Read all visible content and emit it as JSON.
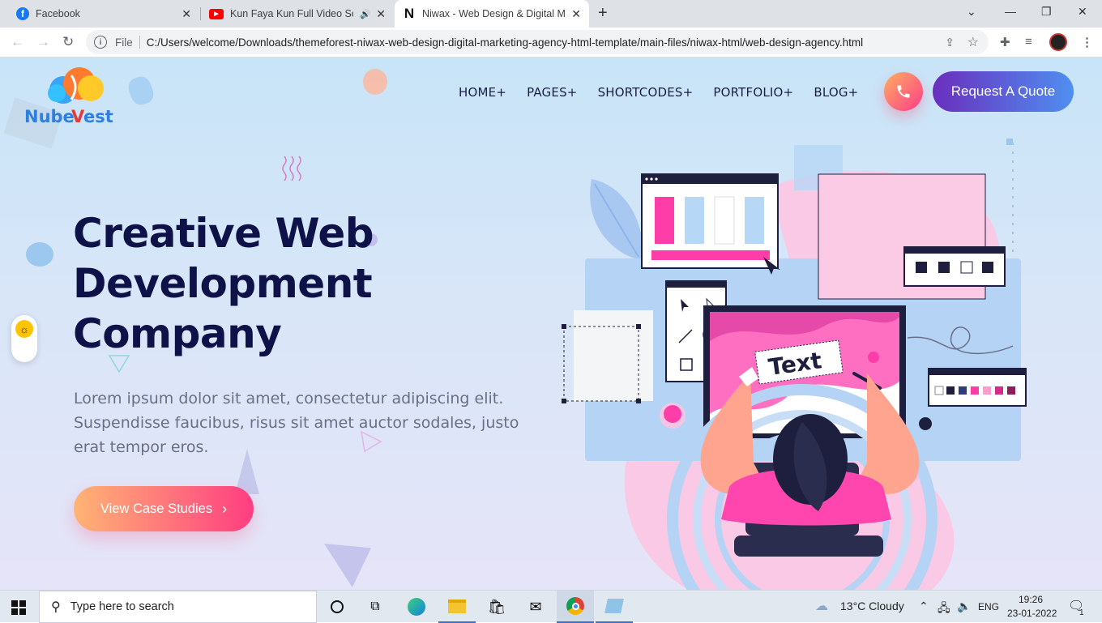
{
  "browser": {
    "tabs": [
      {
        "title": "Facebook",
        "favicon": "facebook-icon",
        "active": false
      },
      {
        "title": "Kun Faya Kun Full Video Song",
        "favicon": "youtube-icon",
        "audio": true,
        "active": false
      },
      {
        "title": "Niwax - Web Design & Digital Ma",
        "favicon": "niwax-icon",
        "favicon_letter": "N",
        "active": true
      }
    ],
    "address": {
      "scheme_label": "File",
      "url": "C:/Users/welcome/Downloads/themeforest-niwax-web-design-digital-marketing-agency-html-template/main-files/niwax-html/web-design-agency.html"
    }
  },
  "site": {
    "logo_text": "NubeVest",
    "nav": [
      "HOME+",
      "PAGES+",
      "SHORTCODES+",
      "PORTFOLIO+",
      "BLOG+"
    ],
    "quote_button": "Request A Quote",
    "hero": {
      "title": "Creative Web Development Company",
      "description": "Lorem ipsum dolor sit amet, consectetur adipiscing elit. Suspendisse faucibus, risus sit amet auctor sodales, justo erat tempor eros.",
      "cta": "View Case Studies",
      "illustration_text": "Text"
    }
  },
  "taskbar": {
    "search_placeholder": "Type here to search",
    "weather": "13°C  Cloudy",
    "language": "ENG",
    "time": "19:26",
    "date": "23-01-2022",
    "notification_count": "1"
  },
  "colors": {
    "accent_pink": "#ff3d82",
    "accent_orange": "#ffb474",
    "navy": "#0e1248",
    "quote_gradient_start": "#6a2fbe",
    "quote_gradient_end": "#4f8ff0"
  }
}
